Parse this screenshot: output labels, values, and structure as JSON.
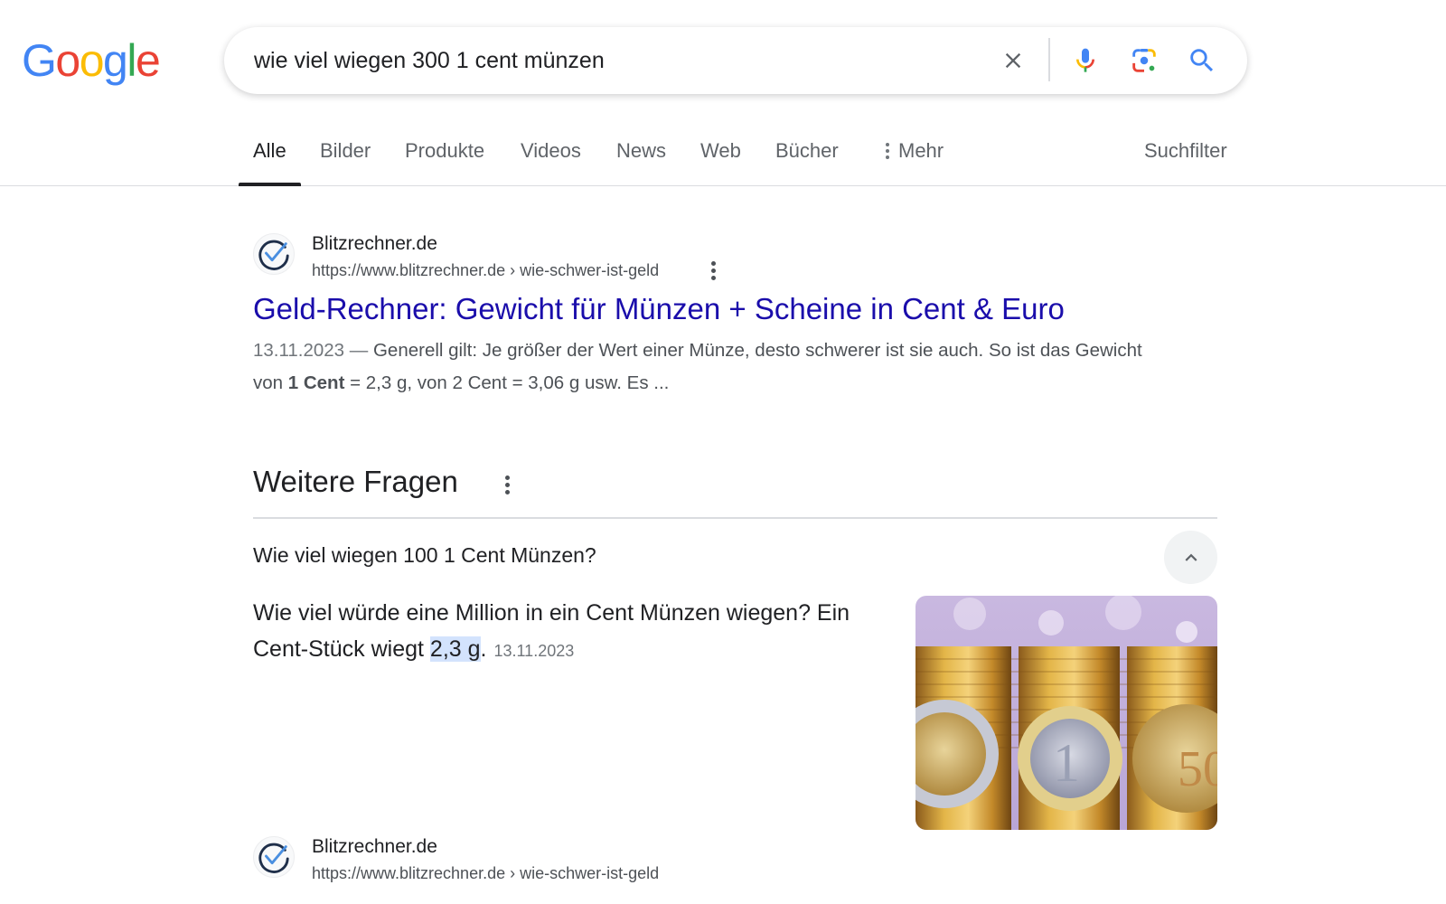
{
  "logo": {
    "letters": [
      {
        "char": "G",
        "color": "#4285F4"
      },
      {
        "char": "o",
        "color": "#EA4335"
      },
      {
        "char": "o",
        "color": "#FBBC05"
      },
      {
        "char": "g",
        "color": "#4285F4"
      },
      {
        "char": "l",
        "color": "#34A853"
      },
      {
        "char": "e",
        "color": "#EA4335"
      }
    ]
  },
  "search": {
    "query": "wie viel wiegen 300 1 cent münzen",
    "icons": [
      "clear-icon",
      "microphone-icon",
      "google-lens-icon",
      "search-icon"
    ]
  },
  "tabs": [
    {
      "label": "Alle",
      "active": true
    },
    {
      "label": "Bilder"
    },
    {
      "label": "Produkte"
    },
    {
      "label": "Videos"
    },
    {
      "label": "News"
    },
    {
      "label": "Web"
    },
    {
      "label": "Bücher"
    },
    {
      "label": "Mehr"
    }
  ],
  "tools_label": "Suchfilter",
  "result1": {
    "site_name": "Blitzrechner.de",
    "url": "https://www.blitzrechner.de › wie-schwer-ist-geld",
    "title": "Geld-Rechner: Gewicht für Münzen + Scheine in Cent & Euro",
    "snippet": {
      "date": "13.11.2023 —",
      "text_before": " Generell gilt: Je größer der Wert einer Münze, desto schwerer ist sie auch. So ist das Gewicht von ",
      "bold": "1 Cent",
      "text_after": " = 2,3 g, von 2 Cent = 3,06 g usw. Es ..."
    }
  },
  "paa": {
    "heading": "Weitere Fragen",
    "question": "Wie viel wiegen 100 1 Cent Münzen?",
    "answer_before": "Wie viel würde eine Million in ein Cent Münzen wiegen? Ein Cent-Stück wiegt ",
    "answer_highlight": "2,3 g",
    "answer_after": ".",
    "answer_date": "13.11.2023",
    "image_alt": "Euro-Münzen vor Münzstapeln"
  },
  "result2": {
    "site_name": "Blitzrechner.de",
    "url": "https://www.blitzrechner.de › wie-schwer-ist-geld"
  }
}
